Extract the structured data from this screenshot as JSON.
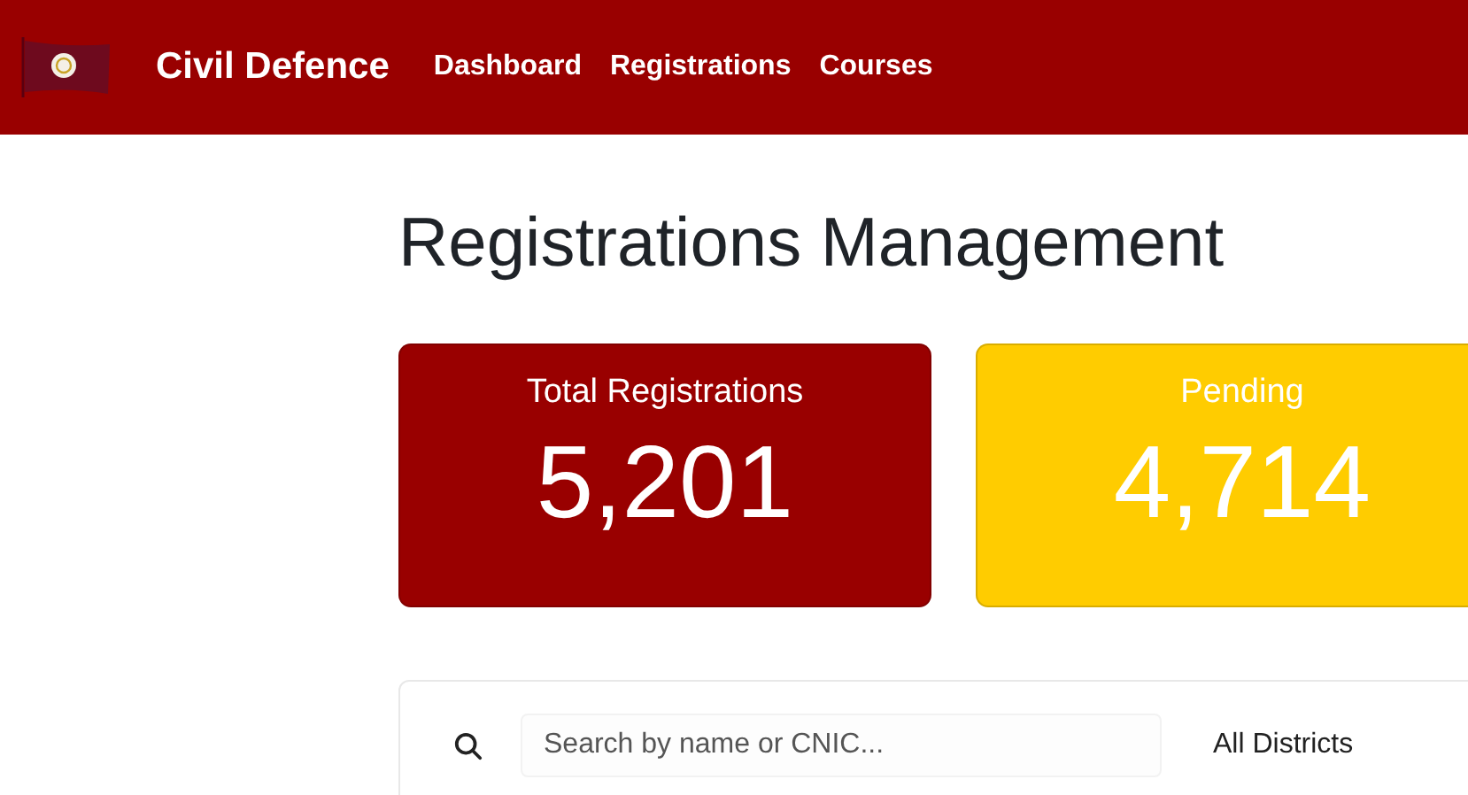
{
  "navbar": {
    "brand": "Civil Defence",
    "links": [
      {
        "label": "Dashboard"
      },
      {
        "label": "Registrations"
      },
      {
        "label": "Courses"
      }
    ]
  },
  "page": {
    "title": "Registrations Management"
  },
  "stats": [
    {
      "label": "Total Registrations",
      "value": "5,201",
      "color": "#990000"
    },
    {
      "label": "Pending",
      "value": "4,714",
      "color": "#ffcc00"
    }
  ],
  "filters": {
    "search": {
      "placeholder": "Search by name or CNIC..."
    },
    "district": {
      "value": "All Districts"
    }
  }
}
